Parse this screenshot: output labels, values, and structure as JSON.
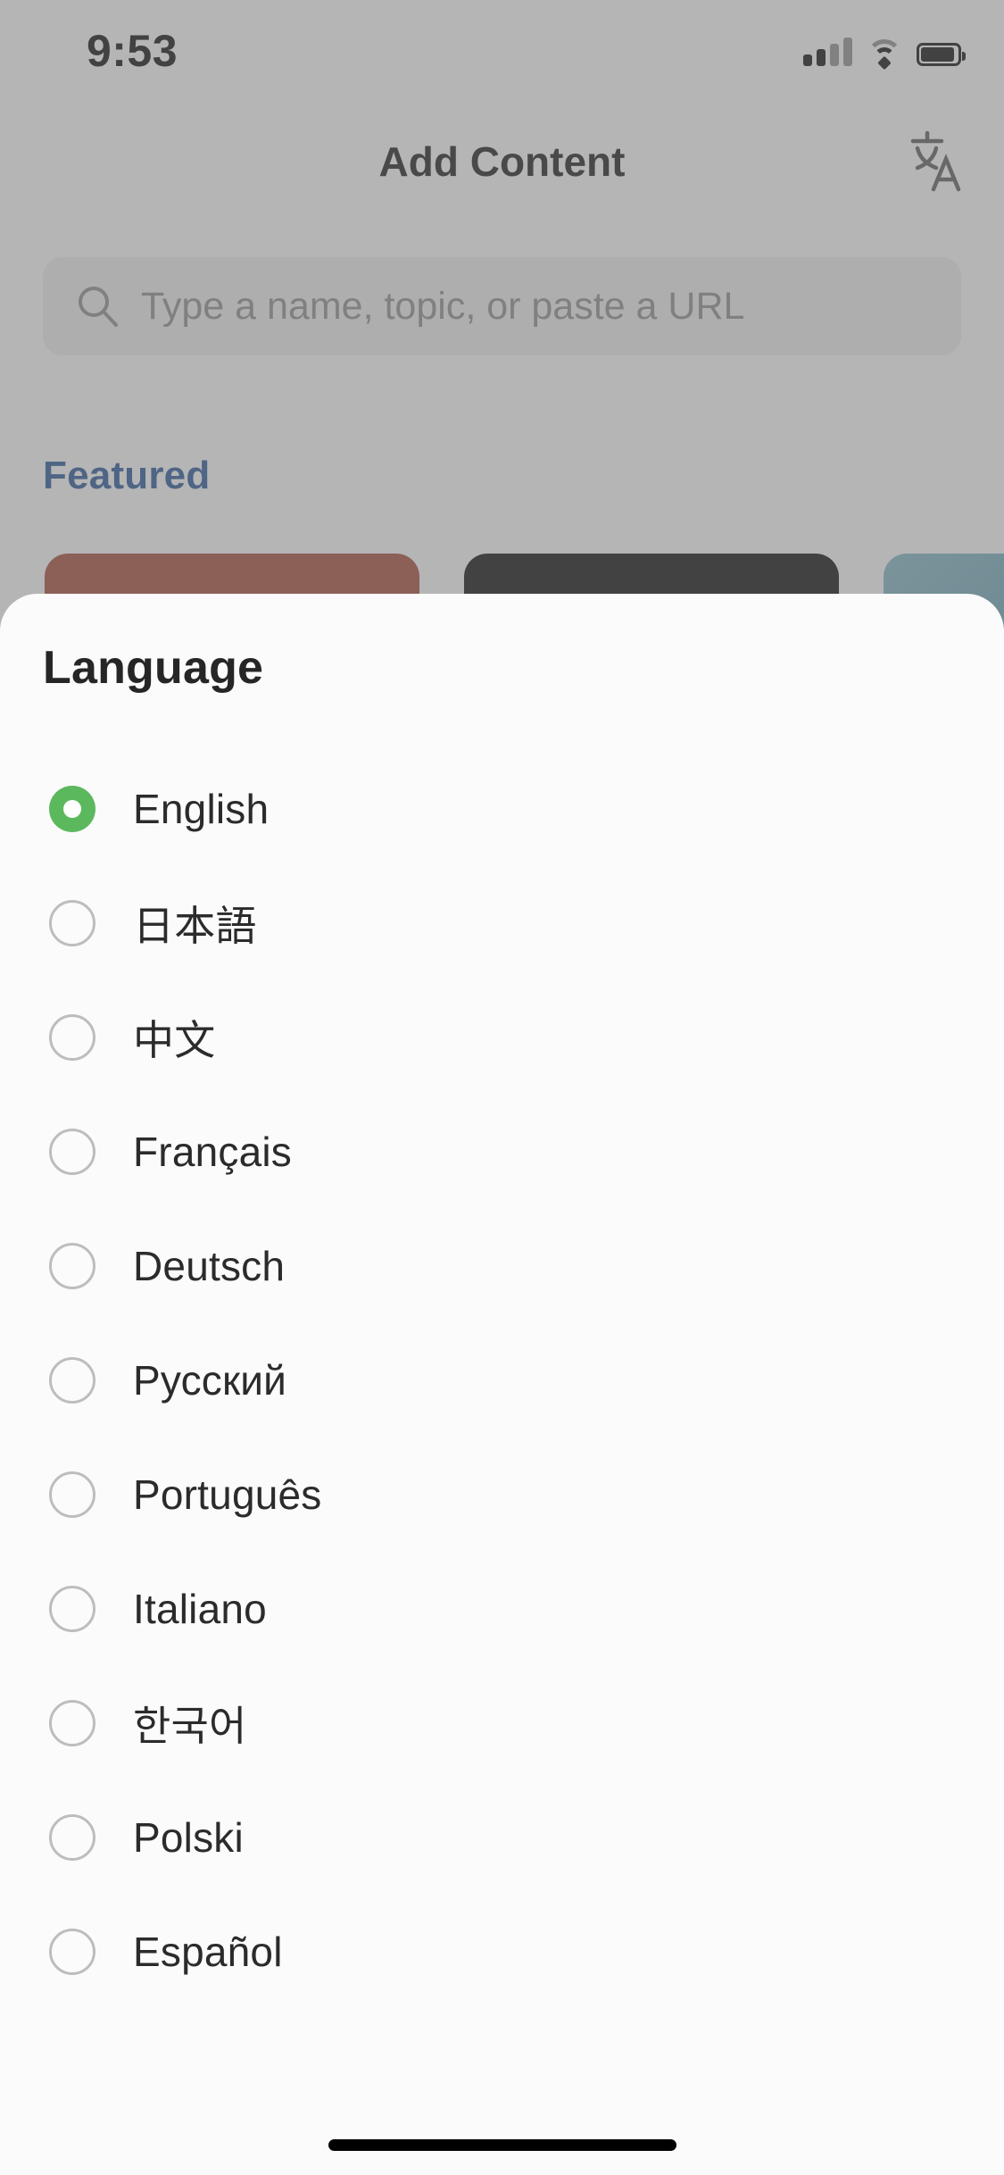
{
  "status_bar": {
    "time": "9:53",
    "signal_icon": "cellular-signal-icon",
    "wifi_icon": "wifi-icon",
    "battery_icon": "battery-icon"
  },
  "header": {
    "title": "Add Content",
    "translate_icon": "translate-icon",
    "translate_glyph_cjk": "文",
    "translate_glyph_latin": "A"
  },
  "search": {
    "placeholder": "Type a name, topic, or paste a URL",
    "value": "",
    "icon": "search-icon"
  },
  "featured": {
    "label": "Featured",
    "label_color": "#1d4e96",
    "cards": [
      {
        "name": "featured-card-1",
        "color": "#a4402f"
      },
      {
        "name": "featured-card-2",
        "color": "#000000"
      },
      {
        "name": "featured-card-3",
        "color": "#4d8da4"
      }
    ]
  },
  "sheet": {
    "title": "Language",
    "selected_color": "#5cb85c",
    "selected_value": "English",
    "options": [
      {
        "label": "English",
        "selected": true
      },
      {
        "label": "日本語",
        "selected": false
      },
      {
        "label": "中文",
        "selected": false
      },
      {
        "label": "Français",
        "selected": false
      },
      {
        "label": "Deutsch",
        "selected": false
      },
      {
        "label": "Русский",
        "selected": false
      },
      {
        "label": "Português",
        "selected": false
      },
      {
        "label": "Italiano",
        "selected": false
      },
      {
        "label": "한국어",
        "selected": false
      },
      {
        "label": "Polski",
        "selected": false
      },
      {
        "label": "Español",
        "selected": false
      }
    ]
  },
  "home_indicator": "home-indicator"
}
